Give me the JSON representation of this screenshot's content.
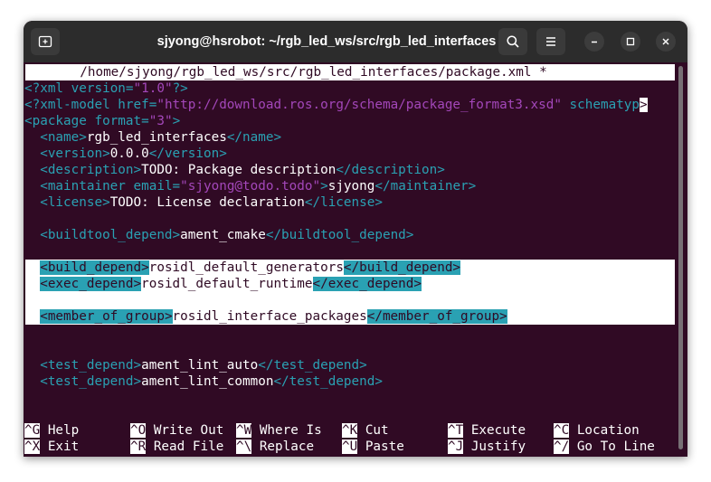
{
  "window": {
    "title": "sjyong@hsrobot: ~/rgb_led_ws/src/rgb_led_interfaces"
  },
  "editor": {
    "header": "       /home/sjyong/rgb_led_ws/src/rgb_led_interfaces/package.xml *",
    "xml_decl": {
      "open": "<?xml",
      "attr": " version=",
      "val": "\"1.0\"",
      "close": "?>"
    },
    "xml_model": {
      "open": "<?xml-model",
      "attr1": " href=",
      "val1": "\"http://download.ros.org/schema/package_format3.xsd\"",
      "attr2": " schematyp",
      "more": ">"
    },
    "package_open": {
      "open": "<package",
      "attr": " format=",
      "val": "\"3\"",
      "close": ">"
    },
    "name": {
      "open": "  <name>",
      "text": "rgb_led_interfaces",
      "close": "</name>"
    },
    "version": {
      "open": "  <version>",
      "text": "0.0.0",
      "close": "</version>"
    },
    "description": {
      "open": "  <description>",
      "text": "TODO: Package description",
      "close": "</description>"
    },
    "maintainer": {
      "open": "  <maintainer",
      "attr": " email=",
      "val": "\"sjyong@todo.todo\"",
      "gt": ">",
      "text": "sjyong",
      "close": "</maintainer>"
    },
    "license": {
      "open": "  <license>",
      "text": "TODO: License declaration",
      "close": "</license>"
    },
    "buildtool": {
      "open": "  <buildtool_depend>",
      "text": "ament_cmake",
      "close": "</buildtool_depend>"
    },
    "build_depend": {
      "indent": "  ",
      "open": "<build_depend>",
      "text": "rosidl_default_generators",
      "close": "</build_depend>"
    },
    "exec_depend": {
      "indent": "  ",
      "open": "<exec_depend>",
      "text": "rosidl_default_runtime",
      "close": "</exec_depend>"
    },
    "member_of_group": {
      "indent": "  ",
      "open": "<member_of_group>",
      "text": "rosidl_interface_packages",
      "close": "</member_of_group>"
    },
    "test_depend_1": {
      "open": "  <test_depend>",
      "text": "ament_lint_auto",
      "close": "</test_depend>"
    },
    "test_depend_2": {
      "open": "  <test_depend>",
      "text": "ament_lint_common",
      "close": "</test_depend>"
    }
  },
  "shortcuts": [
    {
      "key": "^G",
      "label": "Help"
    },
    {
      "key": "^O",
      "label": "Write Out"
    },
    {
      "key": "^W",
      "label": "Where Is"
    },
    {
      "key": "^K",
      "label": "Cut"
    },
    {
      "key": "^T",
      "label": "Execute"
    },
    {
      "key": "^C",
      "label": "Location"
    },
    {
      "key": "^X",
      "label": "Exit"
    },
    {
      "key": "^R",
      "label": "Read File"
    },
    {
      "key": "^\\",
      "label": "Replace"
    },
    {
      "key": "^U",
      "label": "Paste"
    },
    {
      "key": "^J",
      "label": "Justify"
    },
    {
      "key": "^/",
      "label": "Go To Line"
    }
  ],
  "icons": {
    "new_tab": "new-tab-icon",
    "search": "search-icon",
    "menu": "hamburger-menu-icon",
    "minimize": "minimize-icon",
    "maximize": "maximize-icon",
    "close": "close-icon"
  },
  "colors": {
    "terminal_bg": "#300a24",
    "tag": "#2aa1b3",
    "attr_value": "#a347ba",
    "titlebar": "#2c2c2c"
  }
}
